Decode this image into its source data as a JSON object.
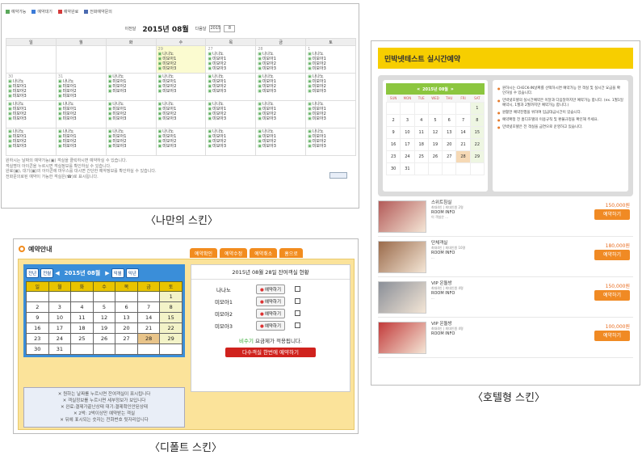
{
  "custom_skin": {
    "legend": [
      {
        "label": "예약가능",
        "color": "#5aa85a"
      },
      {
        "label": "예약대기",
        "color": "#3b7bd8"
      },
      {
        "label": "예약완료",
        "color": "#d43a3a"
      },
      {
        "label": "전화예약문의",
        "color": "#4a6ab0"
      }
    ],
    "prev_label": "이전달",
    "month_title": "2015년 08월",
    "next_label": "다음달",
    "year_select": "2015",
    "month_select": "8",
    "weekdays": [
      "일",
      "월",
      "화",
      "수",
      "목",
      "금",
      "토"
    ],
    "weeks": [
      [
        {
          "d": ""
        },
        {
          "d": ""
        },
        {
          "d": ""
        },
        {
          "d": "29",
          "rooms": [
            "나나노",
            "미모아1",
            "미모아2",
            "미모아3"
          ]
        },
        {
          "d": "27",
          "rooms": [
            "나나노",
            "미모아1",
            "미모아2",
            "미모아3"
          ]
        },
        {
          "d": "28",
          "rooms": [
            "나나노",
            "미모아1",
            "미모아2",
            "미모아3"
          ]
        },
        {
          "d": "1",
          "rooms": [
            "나나노",
            "미모아1",
            "미모아2",
            "미모아3"
          ]
        }
      ],
      [
        {
          "d": "30",
          "rooms": [
            "나나노",
            "미모아1",
            "미모아2",
            "미모아3"
          ]
        },
        {
          "d": "31",
          "rooms": [
            "나나노",
            "미모아1",
            "미모아2",
            "미모아3"
          ]
        },
        {
          "d": "",
          "rooms": [
            "나나노",
            "미모아1",
            "미모아2",
            "미모아3"
          ]
        },
        {
          "d": "",
          "rooms": [
            "나나노",
            "미모아1",
            "미모아2",
            "미모아3"
          ]
        },
        {
          "d": "",
          "rooms": [
            "나나노",
            "미모아1",
            "미모아2",
            "미모아3"
          ]
        },
        {
          "d": "",
          "rooms": [
            "나나노",
            "미모아1",
            "미모아2",
            "미모아3"
          ]
        },
        {
          "d": "",
          "rooms": [
            "나나노",
            "미모아1",
            "미모아2",
            "미모아3"
          ]
        }
      ],
      [
        {
          "d": "",
          "rooms": [
            "나나노",
            "미모아1",
            "미모아2",
            "미모아3"
          ]
        },
        {
          "d": "",
          "rooms": [
            "나나노",
            "미모아1",
            "미모아2",
            "미모아3"
          ]
        },
        {
          "d": "",
          "rooms": [
            "나나노",
            "미모아1",
            "미모아2",
            "미모아3"
          ]
        },
        {
          "d": "",
          "rooms": [
            "나나노",
            "미모아1",
            "미모아2",
            "미모아3"
          ]
        },
        {
          "d": "",
          "rooms": [
            "나나노",
            "미모아1",
            "미모아2",
            "미모아3"
          ]
        },
        {
          "d": "",
          "rooms": [
            "나나노",
            "미모아1",
            "미모아2",
            "미모아3"
          ]
        },
        {
          "d": "",
          "rooms": [
            "나나노",
            "미모아1",
            "미모아2",
            "미모아3"
          ]
        }
      ],
      [
        {
          "d": "",
          "rooms": [
            "나나노",
            "미모아1",
            "미모아2",
            "미모아3"
          ]
        },
        {
          "d": "",
          "rooms": [
            "나나노",
            "미모아1",
            "미모아2",
            "미모아3"
          ]
        },
        {
          "d": "",
          "rooms": [
            "나나노",
            "미모아1",
            "미모아2",
            "미모아3"
          ]
        },
        {
          "d": "",
          "rooms": [
            "나나노",
            "미모아1",
            "미모아2",
            "미모아3"
          ]
        },
        {
          "d": "",
          "rooms": [
            "나나노",
            "미모아1",
            "미모아2",
            "미모아3"
          ]
        },
        {
          "d": "",
          "rooms": [
            "나나노",
            "미모아1",
            "미모아2",
            "미모아3"
          ]
        },
        {
          "d": "",
          "rooms": [
            "나나노",
            "미모아1",
            "미모아2",
            "미모아3"
          ]
        }
      ]
    ],
    "notes": [
      "원하시는 날짜의 예약가능(▣) 객실을 클릭하시면 예약하실 수 있습니다.",
      "객실명이 아이콘을 누르시면 객실정보를 확인하실 수 있습니다.",
      "완료(▣), 대기(▣)의 아이콘에 마우스를 대시면 간단한 예약정보를 확인하실 수 있습니다.",
      "전화문의로된 예약이 가능한 객실은(☎)로 표시됩니다."
    ],
    "caption": "〈나만의 스킨〉"
  },
  "hotel_skin": {
    "title": "민박넷테스트 실시간예약",
    "month_title": "2015년 08월",
    "weekdays": [
      "SUN",
      "MON",
      "TUE",
      "WED",
      "THU",
      "FRI",
      "SAT"
    ],
    "weeks": [
      [
        "",
        "",
        "",
        "",
        "",
        "",
        "1"
      ],
      [
        "2",
        "3",
        "4",
        "5",
        "6",
        "7",
        "8"
      ],
      [
        "9",
        "10",
        "11",
        "12",
        "13",
        "14",
        "15"
      ],
      [
        "16",
        "17",
        "18",
        "19",
        "20",
        "21",
        "22"
      ],
      [
        "23",
        "24",
        "25",
        "26",
        "27",
        "28",
        "29"
      ],
      [
        "30",
        "31",
        "",
        "",
        "",
        "",
        ""
      ]
    ],
    "info": [
      "원하시는 CHECK-IN날짜를 선택하시면 예약가능 한 객실 및 실시간 요금을 확인하실 수 있습니다.",
      "민박넷호텔의 실시간예약은 이달과 다음달까지만 예약가능 합니다. (ex. 1월1일 예약시, 1월과 2월까지만 예약가능 합니다.)",
      "원활한 예약진행을 위하여 입금대금시간이 있습니다.",
      "예약확정 전 홈디호텔의 이용규칙 및 환불규정을 확인해 주세요.",
      "민박넷호텔은 전 객실을 금연으로 운영하고 있습니다."
    ],
    "rooms": [
      {
        "name": "스위트침실",
        "sub": "최대4인 | 최대인원 2명",
        "info": "ROOM INFO",
        "desc": "이 객실은 ...",
        "price": "150,000원",
        "btn": "예약하기",
        "img": "#b35a58"
      },
      {
        "name": "단체객실",
        "sub": "최대4인 | 최대인원 10명",
        "info": "ROOM INFO",
        "desc": "...",
        "price": "180,000원",
        "btn": "예약하기",
        "img": "#9a6a4a"
      },
      {
        "name": "VIP 온돌방",
        "sub": "최대4인 | 최대인원 4명",
        "info": "ROOM INFO",
        "desc": "...",
        "price": "150,000원",
        "btn": "예약하기",
        "img": "#8a8f98"
      },
      {
        "name": "VIP 온돌방",
        "sub": "최대4인 | 최대인원 4명",
        "info": "ROOM INFO",
        "desc": "",
        "price": "100,000원",
        "btn": "예약하기",
        "img": "#c23a3a"
      }
    ],
    "caption": "〈호텔형 스킨〉"
  },
  "default_skin": {
    "title": "예약안내",
    "tabs": [
      "예약확인",
      "예약수정",
      "예약취소",
      "홈으로"
    ],
    "nav": {
      "prev_year": "전년",
      "prev_month": "전월",
      "month_title": "2015년 08월",
      "next_month": "익월",
      "next_year": "익년"
    },
    "weekdays": [
      "일",
      "월",
      "화",
      "수",
      "목",
      "금",
      "토"
    ],
    "weeks": [
      [
        "",
        "",
        "",
        "",
        "",
        "",
        "1"
      ],
      [
        "2",
        "3",
        "4",
        "5",
        "6",
        "7",
        "8"
      ],
      [
        "9",
        "10",
        "11",
        "12",
        "13",
        "14",
        "15"
      ],
      [
        "16",
        "17",
        "18",
        "19",
        "20",
        "21",
        "22"
      ],
      [
        "23",
        "24",
        "25",
        "26",
        "27",
        "28",
        "29"
      ],
      [
        "30",
        "31",
        "",
        "",
        "",
        "",
        ""
      ]
    ],
    "notes": [
      "원하는 날짜를 누르시면 잔여객실이 표시됩니다",
      "객실정보를 누르시면 세부정보가 보입니다",
      "완료:결제가끝난상태 대기:결제확인안된상태",
      "2박: 2박이상만 예약받는 객실",
      "뒤에 표시되는 숫자는 전화번호 뒷자리입니다"
    ],
    "status_title": "2015년 08월 28일 잔여객실 현황",
    "rooms": [
      "나나노",
      "미모아1",
      "미모아2",
      "미모아3"
    ],
    "reserve_btn": "예약하기",
    "season_note": "비수기 요금제가 적용됩니다.",
    "season_word": "비수기",
    "multi_btn": "다수객실 한번에 예약하기",
    "caption": "〈디폴트 스킨〉"
  }
}
